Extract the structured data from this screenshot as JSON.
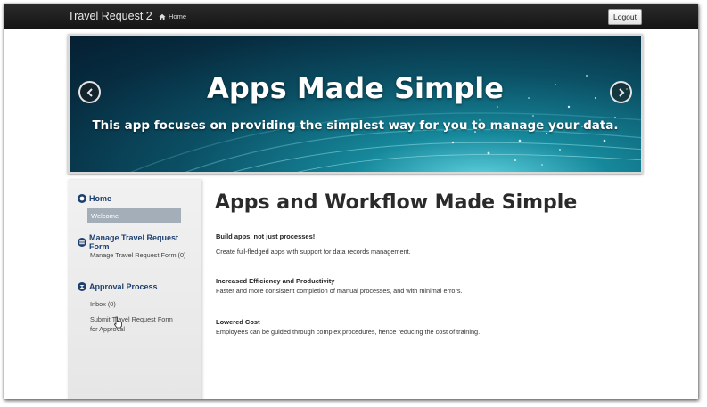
{
  "navbar": {
    "brand": "Travel Request 2",
    "home_label": "Home",
    "logout_label": "Logout"
  },
  "banner": {
    "title": "Apps Made Simple",
    "subtitle": "This app focuses on providing the simplest way for you to manage your data."
  },
  "sidebar": {
    "home": {
      "label": "Home",
      "items": [
        "Welcome"
      ]
    },
    "manage": {
      "label": "Manage Travel Request Form",
      "items": [
        "Manage Travel Request Form (0)"
      ]
    },
    "approval": {
      "label": "Approval Process",
      "items": [
        "Inbox (0)",
        "Submit Travel Request Form for Approval"
      ]
    }
  },
  "main": {
    "title": "Apps and Workflow Made Simple",
    "features": [
      {
        "title": "Build apps, not just processes!",
        "text": "Create full-fledged apps with support for data records management."
      },
      {
        "title": "Increased Efficiency and Productivity",
        "text": "Faster and more consistent completion of manual processes, and with minimal errors."
      },
      {
        "title": "Lowered Cost",
        "text": "Employees can be guided through complex procedures, hence reducing the cost of training."
      }
    ]
  },
  "colors": {
    "navbar": "#1a1a1a",
    "sidebar_heading": "#1c3f6e",
    "sidebar_selected": "#a4aeb8",
    "banner": "#0b4f64"
  },
  "icons": [
    "home-icon",
    "chevron-left-icon",
    "chevron-right-icon",
    "home-section-icon",
    "list-section-icon",
    "process-section-icon",
    "mouse-cursor-icon"
  ]
}
